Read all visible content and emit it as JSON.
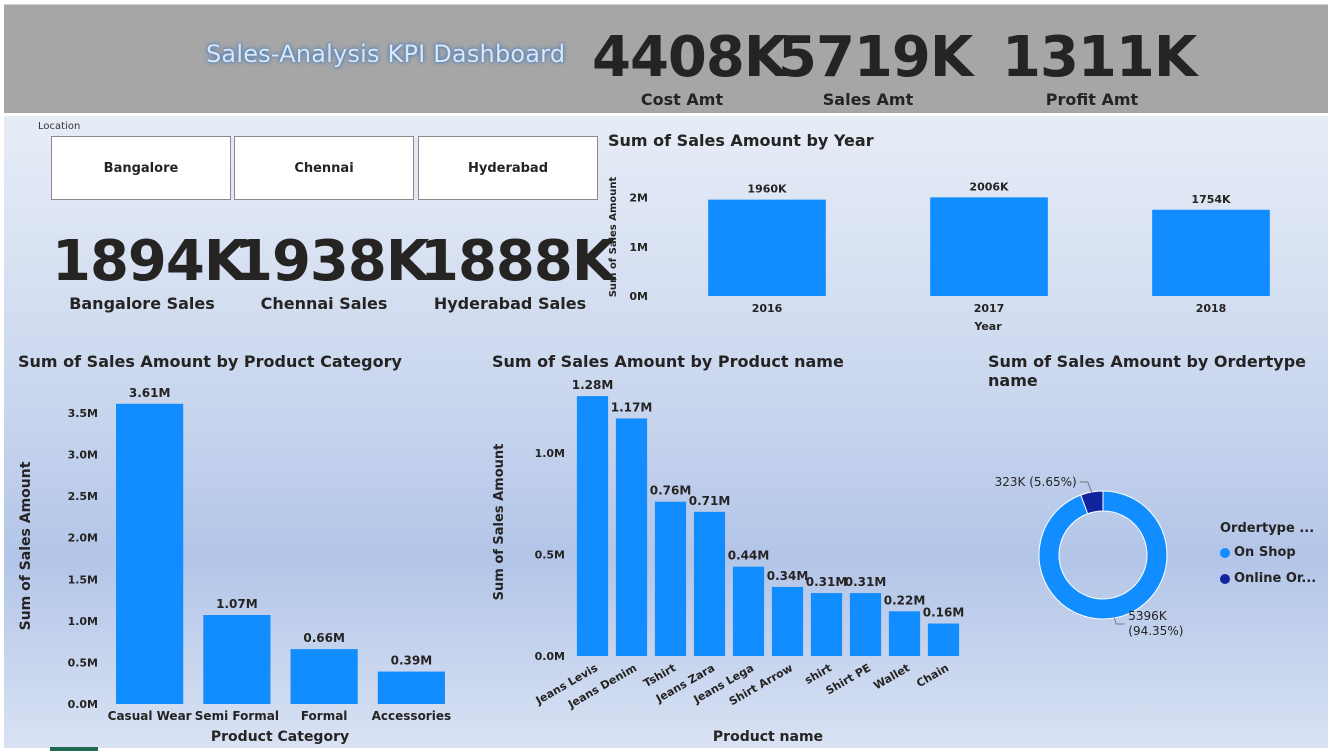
{
  "header": {
    "title": "Sales-Analysis KPI Dashboard",
    "kpis": [
      {
        "value": "4408K",
        "label": "Cost Amt"
      },
      {
        "value": "5719K",
        "label": "Sales Amt"
      },
      {
        "value": "1311K",
        "label": "Profit Amt"
      }
    ]
  },
  "location": {
    "title": "Location",
    "options": [
      "Bangalore",
      "Chennai",
      "Hyderabad"
    ]
  },
  "city_kpis": [
    {
      "value": "1894K",
      "label": "Bangalore Sales"
    },
    {
      "value": "1938K",
      "label": "Chennai Sales"
    },
    {
      "value": "1888K",
      "label": "Hyderabad Sales"
    }
  ],
  "colors": {
    "primary": "#118DFF",
    "secondary": "#12239E"
  },
  "chart_data": [
    {
      "type": "bar",
      "title": "Sum of Sales Amount by Year",
      "xlabel": "Year",
      "ylabel": "Sum of Sales Amount",
      "categories": [
        "2016",
        "2017",
        "2018"
      ],
      "values": [
        1960,
        2006,
        1754
      ],
      "data_labels": [
        "1960K",
        "2006K",
        "1754K"
      ],
      "ylim": [
        0,
        2400
      ],
      "yticks": [
        0,
        1000,
        2000
      ],
      "ytick_labels": [
        "0M",
        "1M",
        "2M"
      ]
    },
    {
      "type": "bar",
      "title": "Sum of Sales Amount by Product Category",
      "xlabel": "Product Category",
      "ylabel": "Sum of Sales Amount",
      "categories": [
        "Casual Wear",
        "Semi Formal",
        "Formal",
        "Accessories"
      ],
      "values": [
        3.61,
        1.07,
        0.66,
        0.39
      ],
      "data_labels": [
        "3.61M",
        "1.07M",
        "0.66M",
        "0.39M"
      ],
      "ylim": [
        0,
        3.8
      ],
      "yticks": [
        0,
        0.5,
        1.0,
        1.5,
        2.0,
        2.5,
        3.0,
        3.5
      ],
      "ytick_labels": [
        "0.0M",
        "0.5M",
        "1.0M",
        "1.5M",
        "2.0M",
        "2.5M",
        "3.0M",
        "3.5M"
      ]
    },
    {
      "type": "bar",
      "title": "Sum of Sales Amount by Product name",
      "xlabel": "Product name",
      "ylabel": "Sum of Sales Amount",
      "categories": [
        "Jeans Levis",
        "Jeans Denim",
        "Tshirt",
        "Jeans Zara",
        "Jeans Lega",
        "Shirt Arrow",
        "shirt",
        "Shirt PE",
        "Wallet",
        "Chain"
      ],
      "values": [
        1.28,
        1.17,
        0.76,
        0.71,
        0.44,
        0.34,
        0.31,
        0.31,
        0.22,
        0.16
      ],
      "data_labels": [
        "1.28M",
        "1.17M",
        "0.76M",
        "0.71M",
        "0.44M",
        "0.34M",
        "0.31M",
        "0.31M",
        "0.22M",
        "0.16M"
      ],
      "ylim": [
        0,
        1.32
      ],
      "yticks": [
        0,
        0.5,
        1.0
      ],
      "ytick_labels": [
        "0.0M",
        "0.5M",
        "1.0M"
      ]
    },
    {
      "type": "pie",
      "title": "Sum of Sales Amount by Ordertype name",
      "legend_title": "Ordertype ...",
      "categories": [
        "On Shop",
        "Online Or..."
      ],
      "values": [
        5396,
        323
      ],
      "data_labels": [
        "5396K (94.35%)",
        "323K (5.65%)"
      ],
      "legend": "right"
    }
  ]
}
